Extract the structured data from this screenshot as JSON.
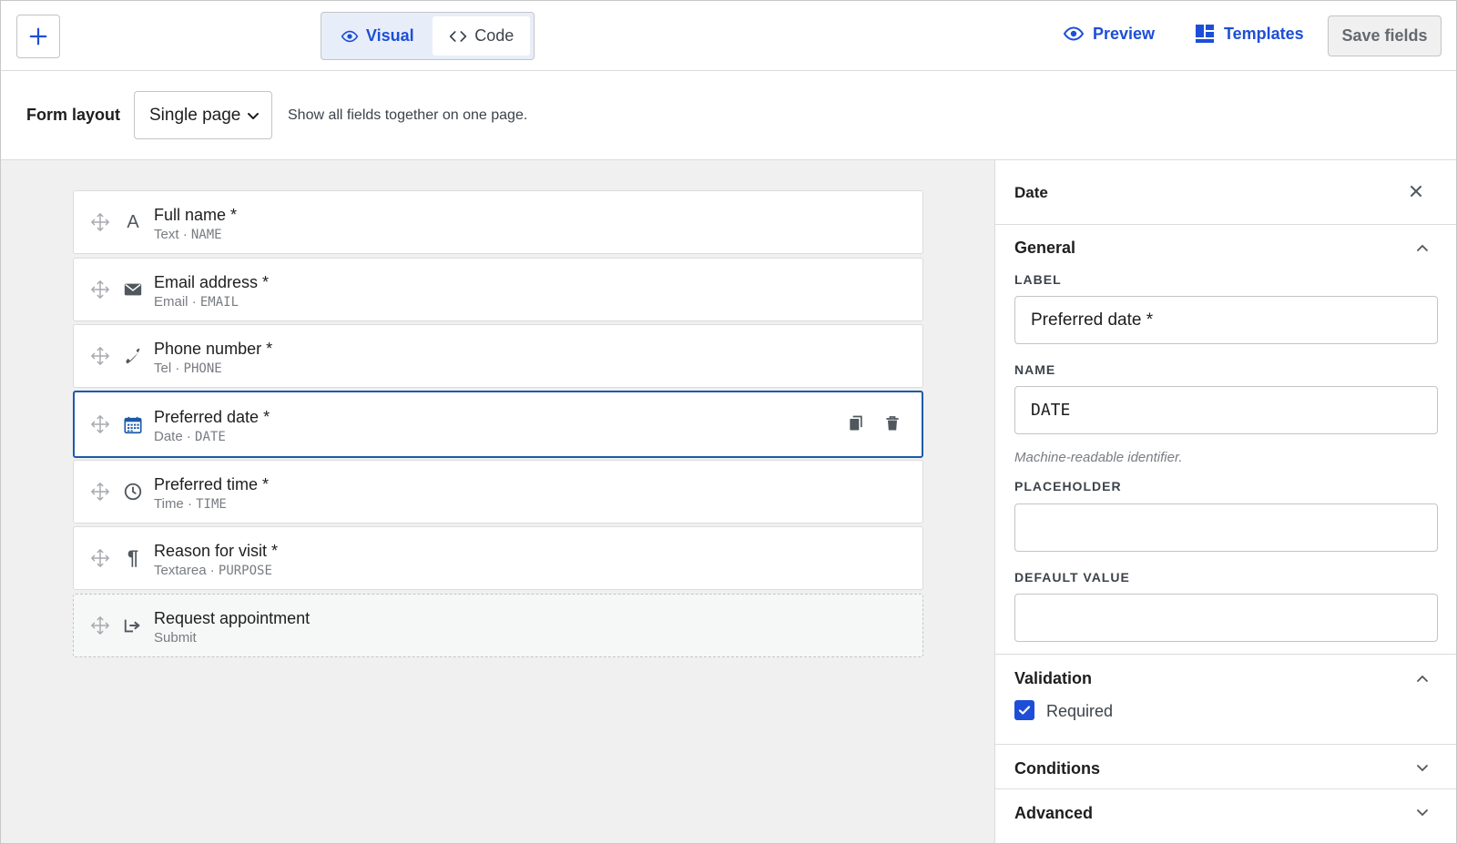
{
  "toolbar": {
    "add_icon": "plus-icon",
    "modes": {
      "visual": "Visual",
      "code": "Code",
      "active": "visual"
    },
    "preview": "Preview",
    "templates": "Templates",
    "save": "Save fields"
  },
  "layout": {
    "label": "Form layout",
    "selected": "Single page",
    "help": "Show all fields together on one page."
  },
  "fields": [
    {
      "title": "Full name *",
      "type": "Text",
      "name": "NAME",
      "icon": "text-icon"
    },
    {
      "title": "Email address *",
      "type": "Email",
      "name": "EMAIL",
      "icon": "envelope-icon"
    },
    {
      "title": "Phone number *",
      "type": "Tel",
      "name": "PHONE",
      "icon": "phone-icon"
    },
    {
      "title": "Preferred date *",
      "type": "Date",
      "name": "DATE",
      "icon": "calendar-icon",
      "selected": true
    },
    {
      "title": "Preferred time *",
      "type": "Time",
      "name": "TIME",
      "icon": "clock-icon"
    },
    {
      "title": "Reason for visit *",
      "type": "Textarea",
      "name": "PURPOSE",
      "icon": "paragraph-icon"
    },
    {
      "title": "Request appointment",
      "type": "Submit",
      "icon": "submit-icon"
    }
  ],
  "field_separator": "·",
  "sidebar": {
    "title": "Date",
    "general": {
      "title": "General",
      "label_caption": "LABEL",
      "label_value": "Preferred date *",
      "name_caption": "NAME",
      "name_value": "DATE",
      "name_help": "Machine-readable identifier.",
      "placeholder_caption": "PLACEHOLDER",
      "placeholder_value": "",
      "default_caption": "DEFAULT VALUE",
      "default_value": ""
    },
    "validation": {
      "title": "Validation",
      "required_label": "Required",
      "required": true
    },
    "conditions": {
      "title": "Conditions"
    },
    "advanced": {
      "title": "Advanced"
    }
  },
  "colors": {
    "accent": "#1d4ed8",
    "selected_border": "#1e5aa8",
    "canvas_bg": "#f0f0f0"
  }
}
